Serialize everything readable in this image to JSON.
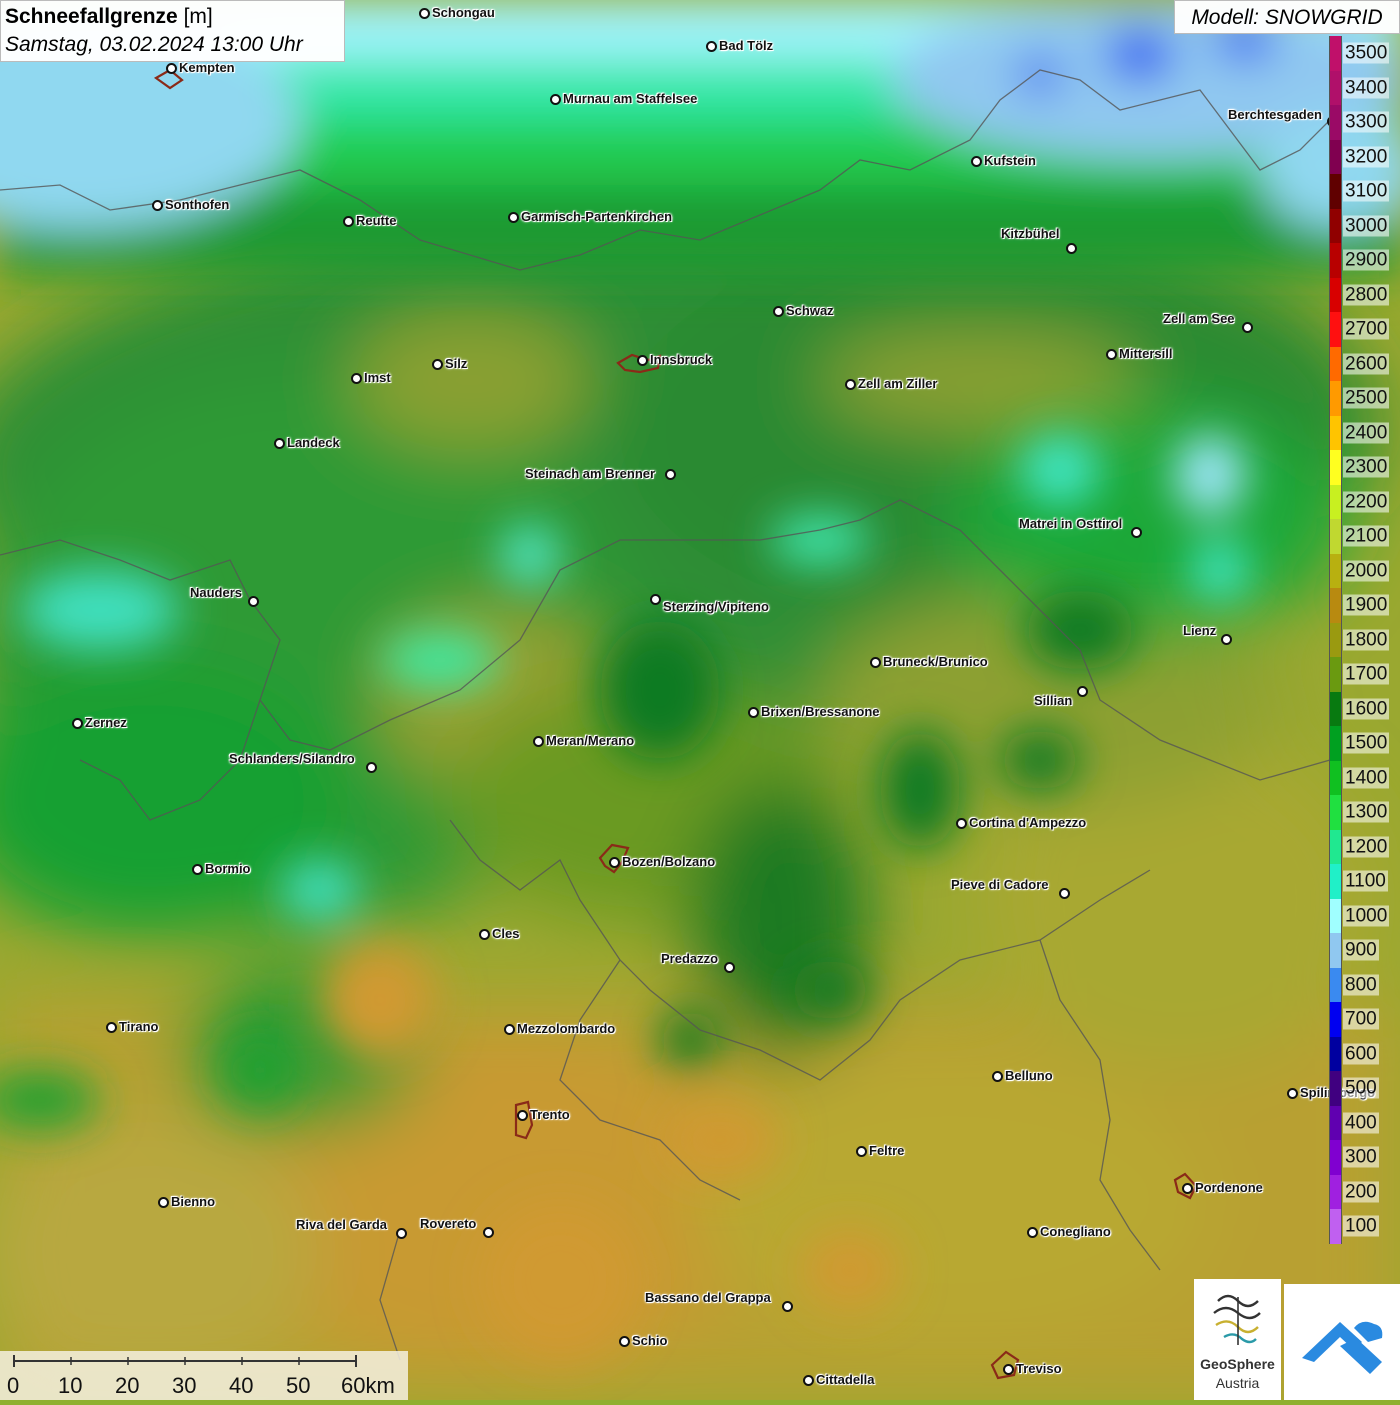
{
  "header": {
    "title": "Schneefallgrenze",
    "unit": "[m]",
    "datetime": "Samstag, 03.02.2024 13:00 Uhr"
  },
  "model": {
    "label": "Modell: SNOWGRID"
  },
  "legend": {
    "items": [
      {
        "value": "3500",
        "color": "#c0106a"
      },
      {
        "value": "3400",
        "color": "#b0106a"
      },
      {
        "value": "3300",
        "color": "#9a0a66"
      },
      {
        "value": "3200",
        "color": "#800050"
      },
      {
        "value": "3100",
        "color": "#600000"
      },
      {
        "value": "3000",
        "color": "#900000"
      },
      {
        "value": "2900",
        "color": "#b80000"
      },
      {
        "value": "2800",
        "color": "#d80000"
      },
      {
        "value": "2700",
        "color": "#ff1010"
      },
      {
        "value": "2600",
        "color": "#ff6a00"
      },
      {
        "value": "2500",
        "color": "#ff9a00"
      },
      {
        "value": "2400",
        "color": "#ffc400"
      },
      {
        "value": "2300",
        "color": "#ffff20"
      },
      {
        "value": "2200",
        "color": "#c8f020"
      },
      {
        "value": "2100",
        "color": "#c0d830"
      },
      {
        "value": "2000",
        "color": "#b8b010"
      },
      {
        "value": "1900",
        "color": "#b88a10"
      },
      {
        "value": "1800",
        "color": "#9a9a10"
      },
      {
        "value": "1700",
        "color": "#6a9a10"
      },
      {
        "value": "1600",
        "color": "#087a10"
      },
      {
        "value": "1500",
        "color": "#00a020"
      },
      {
        "value": "1400",
        "color": "#10c020"
      },
      {
        "value": "1300",
        "color": "#20e040"
      },
      {
        "value": "1200",
        "color": "#20e890"
      },
      {
        "value": "1100",
        "color": "#20f0c8"
      },
      {
        "value": "1000",
        "color": "#a0ffff"
      },
      {
        "value": "900",
        "color": "#90c8f0"
      },
      {
        "value": "800",
        "color": "#3a8af0"
      },
      {
        "value": "700",
        "color": "#0000f0"
      },
      {
        "value": "600",
        "color": "#0000a0"
      },
      {
        "value": "500",
        "color": "#400080"
      },
      {
        "value": "400",
        "color": "#6000b0"
      },
      {
        "value": "300",
        "color": "#8000d0"
      },
      {
        "value": "200",
        "color": "#a020e0"
      },
      {
        "value": "100",
        "color": "#c060f0"
      }
    ]
  },
  "cities": [
    {
      "name": "Schongau"
    },
    {
      "name": "Bad Tölz"
    },
    {
      "name": "Kempten"
    },
    {
      "name": "Murnau am Staffelsee"
    },
    {
      "name": "Berchtesgaden"
    },
    {
      "name": "Kufstein"
    },
    {
      "name": "Sonthofen"
    },
    {
      "name": "Reutte"
    },
    {
      "name": "Garmisch-Partenkirchen"
    },
    {
      "name": "Kitzbühel"
    },
    {
      "name": "Schwaz"
    },
    {
      "name": "Zell am See"
    },
    {
      "name": "Innsbruck"
    },
    {
      "name": "Mittersill"
    },
    {
      "name": "Imst"
    },
    {
      "name": "Silz"
    },
    {
      "name": "Zell am Ziller"
    },
    {
      "name": "Landeck"
    },
    {
      "name": "Steinach am Brenner"
    },
    {
      "name": "Matrei in Osttirol"
    },
    {
      "name": "Nauders"
    },
    {
      "name": "Sterzing/Vipiteno"
    },
    {
      "name": "Lienz"
    },
    {
      "name": "Bruneck/Brunico"
    },
    {
      "name": "Sillian"
    },
    {
      "name": "Zernez"
    },
    {
      "name": "Brixen/Bressanone"
    },
    {
      "name": "Meran/Merano"
    },
    {
      "name": "Schlanders/Silandro"
    },
    {
      "name": "Cortina d'Ampezzo"
    },
    {
      "name": "Bozen/Bolzano"
    },
    {
      "name": "Bormio"
    },
    {
      "name": "Pieve di Cadore"
    },
    {
      "name": "Cles"
    },
    {
      "name": "Predazzo"
    },
    {
      "name": "Tirano"
    },
    {
      "name": "Mezzolombardo"
    },
    {
      "name": "Belluno"
    },
    {
      "name": "Spilimbergo"
    },
    {
      "name": "Trento"
    },
    {
      "name": "Feltre"
    },
    {
      "name": "Pordenone"
    },
    {
      "name": "Bienno"
    },
    {
      "name": "Riva del Garda"
    },
    {
      "name": "Rovereto"
    },
    {
      "name": "Conegliano"
    },
    {
      "name": "Bassano del Grappa"
    },
    {
      "name": "Schio"
    },
    {
      "name": "Treviso"
    },
    {
      "name": "Cittadella"
    }
  ],
  "scale_bar": {
    "labels": [
      "0",
      "10",
      "20",
      "30",
      "40",
      "50",
      "60km"
    ]
  },
  "logos": {
    "geosphere_line1": "GeoSphere",
    "geosphere_line2": "Austria"
  }
}
